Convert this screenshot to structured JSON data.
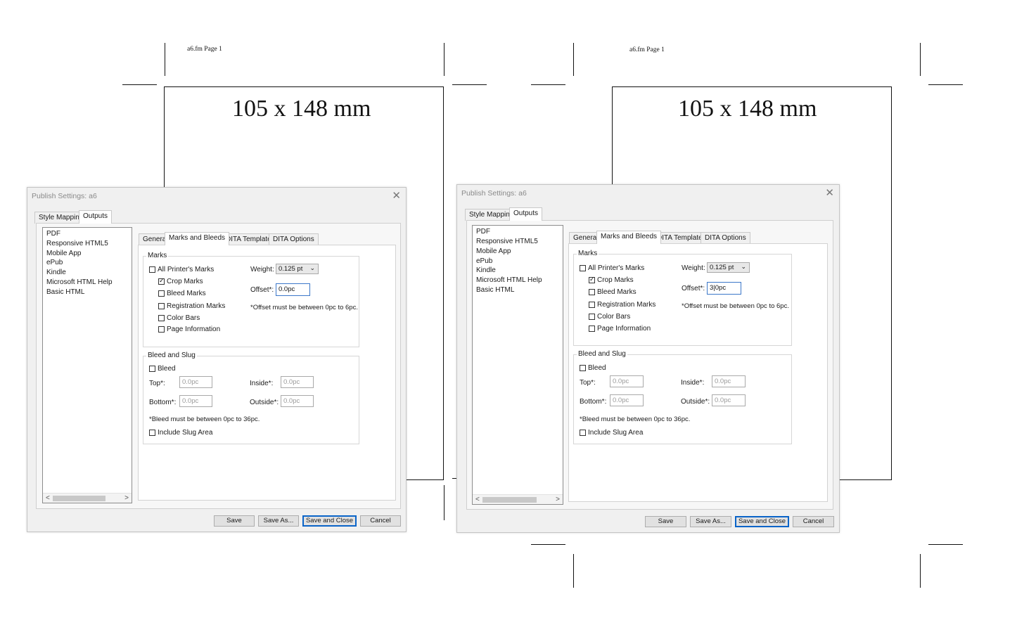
{
  "page": {
    "header": "a6.fm  Page 1",
    "heading": "105 x 148 mm"
  },
  "dialog": {
    "title": "Publish Settings: a6",
    "close_glyph": "✕",
    "top_tabs": [
      "Style Mapping",
      "Outputs"
    ],
    "outputs": [
      "PDF",
      "Responsive HTML5",
      "Mobile App",
      "ePub",
      "Kindle",
      "Microsoft HTML Help",
      "Basic HTML"
    ],
    "sub_tabs": [
      "General",
      "Marks and Bleeds",
      "DITA Template",
      "DITA Options"
    ],
    "marks": {
      "label": "Marks",
      "all_printers": "All Printer's Marks",
      "crop": "Crop Marks",
      "bleed": "Bleed Marks",
      "registration": "Registration Marks",
      "color_bars": "Color Bars",
      "page_info": "Page Information",
      "weight_label": "Weight:",
      "weight_value": "0.125 pt",
      "offset_label": "Offset*:",
      "offset_note": "*Offset must be between 0pc to 6pc."
    },
    "bleed": {
      "label": "Bleed and Slug",
      "bleed_check": "Bleed",
      "top_label": "Top*:",
      "top_value": "0.0pc",
      "bottom_label": "Bottom*:",
      "bottom_value": "0.0pc",
      "inside_label": "Inside*:",
      "inside_value": "0.0pc",
      "outside_label": "Outside*:",
      "outside_value": "0.0pc",
      "note": "*Bleed must be between 0pc to 36pc.",
      "slug": "Include Slug Area"
    },
    "buttons": {
      "save": "Save",
      "save_as": "Save As...",
      "save_close": "Save and Close",
      "cancel": "Cancel"
    }
  },
  "left": {
    "offset_value": "0.0pc"
  },
  "right": {
    "offset_value": "3|0pc"
  }
}
